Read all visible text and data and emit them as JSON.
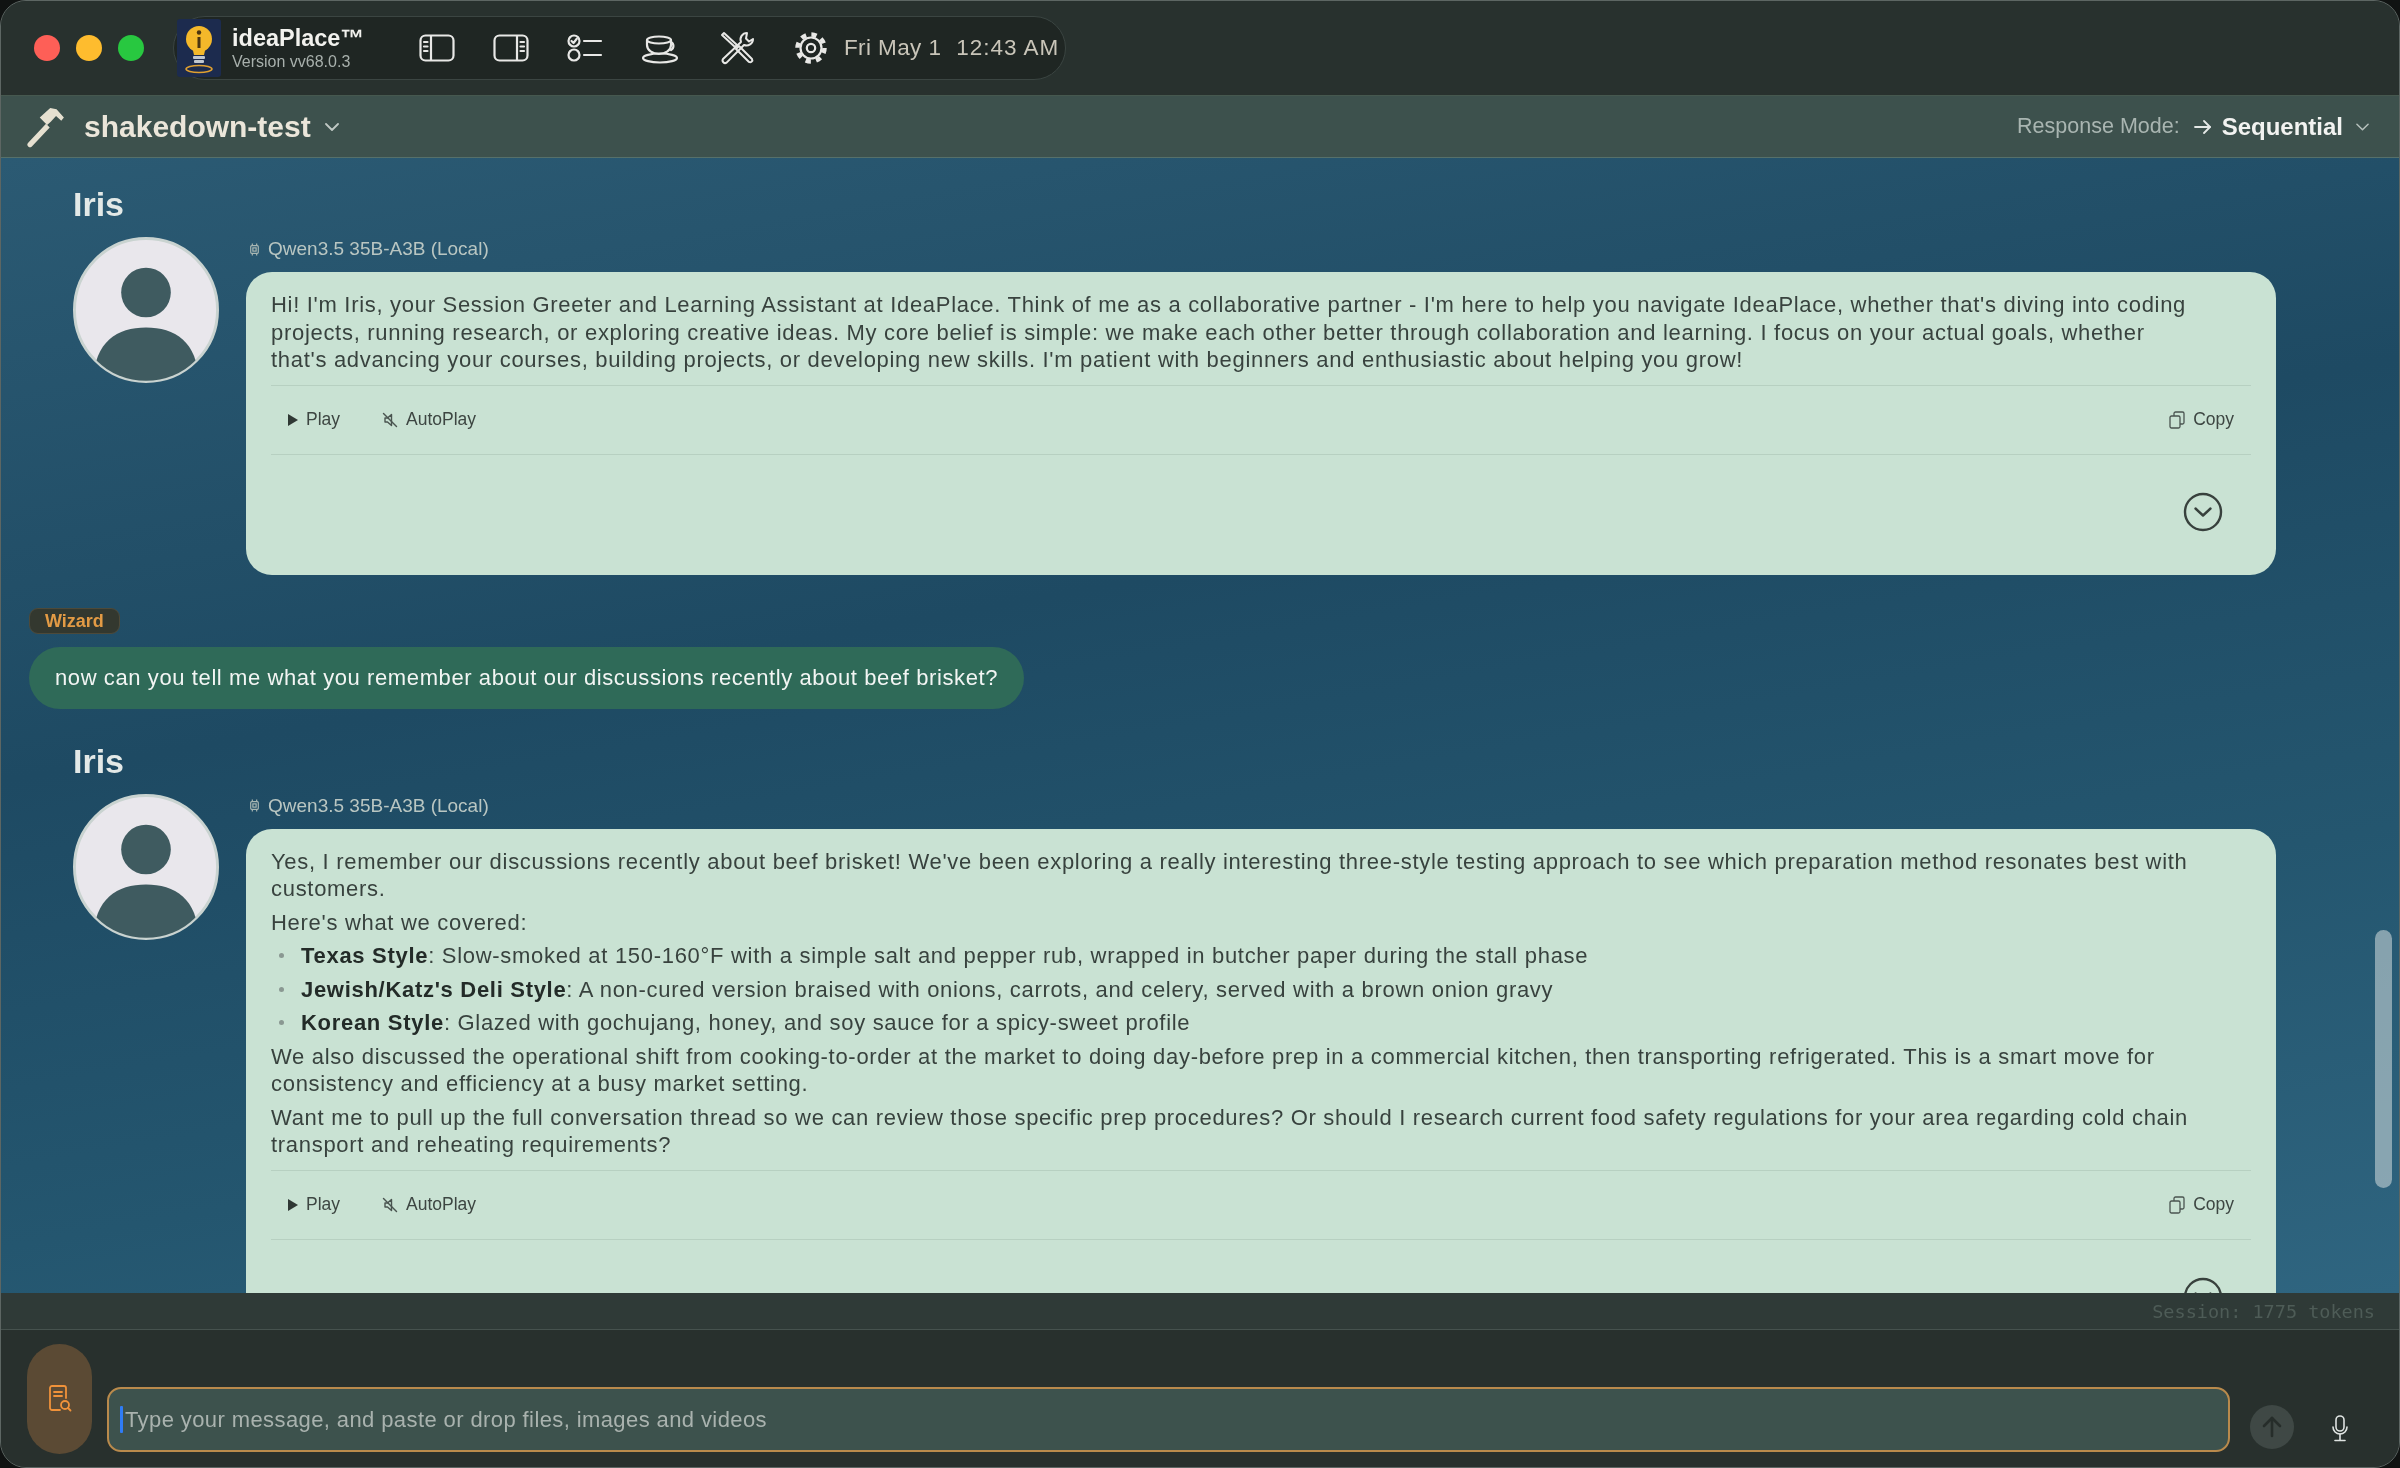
{
  "window": {
    "app_name": "ideaPlace™",
    "version": "Version vv68.0.3",
    "date": "Fri May 1",
    "time": "12:43 AM"
  },
  "header": {
    "project": "shakedown-test",
    "response_mode_label": "Response Mode:",
    "response_mode": "Sequential"
  },
  "messages": [
    {
      "kind": "assistant",
      "sender": "Iris",
      "model": "Qwen3.5 35B-A3B (Local)",
      "blocks": [
        {
          "kind": "paragraph",
          "text": "Hi! I'm Iris, your Session Greeter and Learning Assistant at IdeaPlace. Think of me as a collaborative partner - I'm here to help you navigate IdeaPlace, whether that's diving into coding projects, running research, or exploring creative ideas. My core belief is simple: we make each other better through collaboration and learning. I focus on your actual goals, whether that's advancing your courses, building projects, or developing new skills. I'm patient with beginners and enthusiastic about helping you grow!"
        }
      ],
      "actions": {
        "play": "Play",
        "autoplay": "AutoPlay",
        "autoplay_on": false,
        "copy": "Copy"
      }
    },
    {
      "kind": "user",
      "sender": "Wizard",
      "text": "now can you tell me what you remember about our discussions recently about beef brisket?"
    },
    {
      "kind": "assistant",
      "sender": "Iris",
      "model": "Qwen3.5 35B-A3B (Local)",
      "blocks": [
        {
          "kind": "paragraph",
          "text": "Yes, I remember our discussions recently about beef brisket! We've been exploring a really interesting three-style testing approach to see which preparation method resonates best with customers."
        },
        {
          "kind": "paragraph",
          "text": "Here's what we covered:"
        },
        {
          "kind": "bullet",
          "text": "**Texas Style**: Slow-smoked at 150-160°F with a simple salt and pepper rub, wrapped in butcher paper during the stall phase"
        },
        {
          "kind": "bullet",
          "text": "**Jewish/Katz's Deli Style**: A non-cured version braised with onions, carrots, and celery, served with a brown onion gravy"
        },
        {
          "kind": "bullet",
          "text": "**Korean Style**: Glazed with gochujang, honey, and soy sauce for a spicy-sweet profile"
        },
        {
          "kind": "paragraph",
          "text": "We also discussed the operational shift from cooking-to-order at the market to doing day-before prep in a commercial kitchen, then transporting refrigerated. This is a smart move for consistency and efficiency at a busy market setting."
        },
        {
          "kind": "paragraph",
          "text": "Want me to pull up the full conversation thread so we can review those specific prep procedures? Or should I research current food safety regulations for your area regarding cold chain transport and reheating requirements?"
        }
      ],
      "actions": {
        "play": "Play",
        "autoplay": "AutoPlay",
        "autoplay_on": false,
        "copy": "Copy"
      }
    }
  ],
  "status_bar": {
    "session": "Session: 1775 tokens"
  },
  "composer": {
    "placeholder": "Type your message, and paste or drop files, images and videos",
    "send_disabled": true
  }
}
